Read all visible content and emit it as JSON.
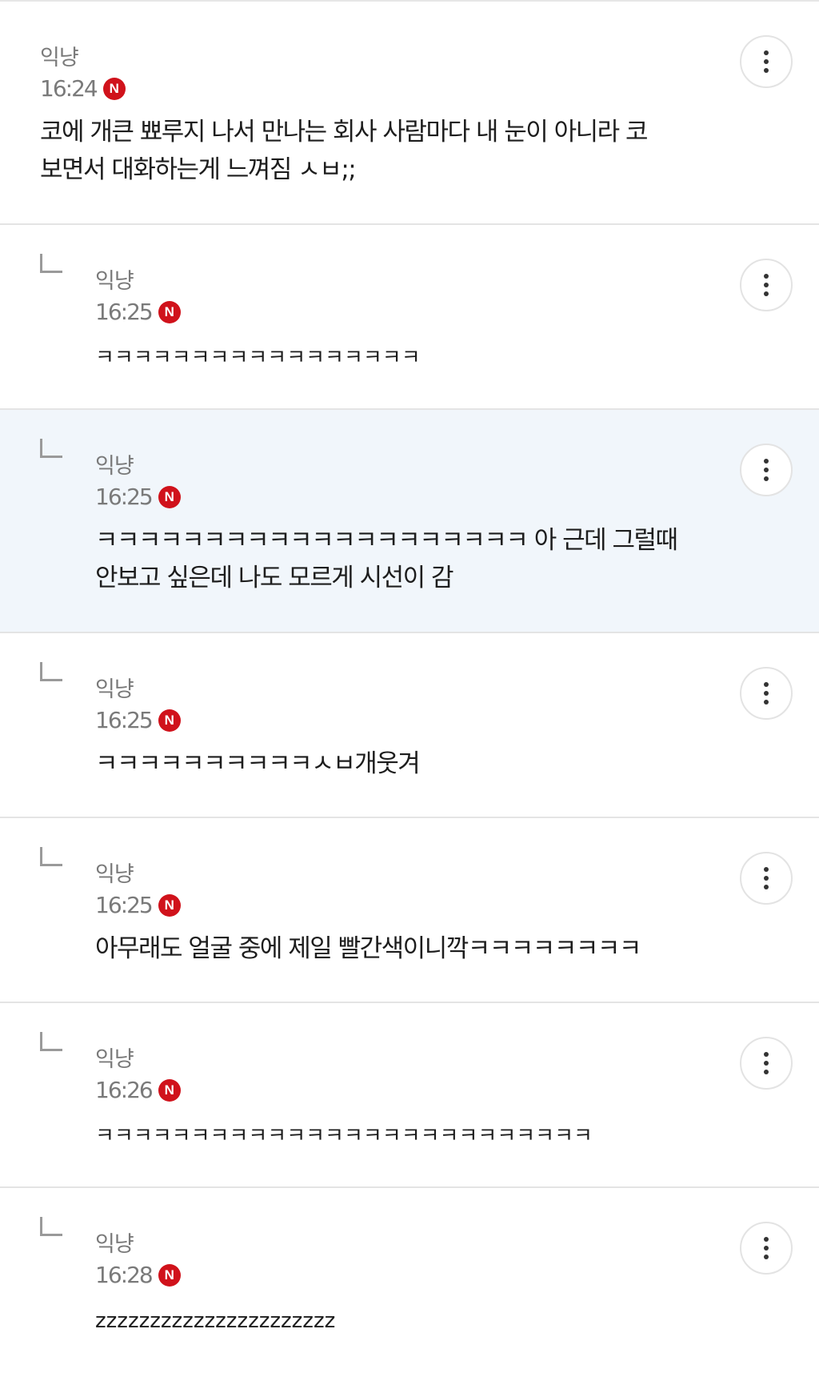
{
  "comments": [
    {
      "author": "익냥",
      "time": "16:24",
      "badge": "N",
      "text": "코에 개큰 뾰루지 나서 만나는 회사 사람마다 내 눈이 아니라 코 보면서 대화하는게 느껴짐 ㅅㅂ;;",
      "is_reply": false,
      "highlighted": false
    },
    {
      "author": "익냥",
      "time": "16:25",
      "badge": "N",
      "text": "ㅋㅋㅋㅋㅋㅋㅋㅋㅋㅋㅋㅋㅋㅋㅋㅋㅋ",
      "is_reply": true,
      "highlighted": false
    },
    {
      "author": "익냥",
      "time": "16:25",
      "badge": "N",
      "text": "ㅋㅋㅋㅋㅋㅋㅋㅋㅋㅋㅋㅋㅋㅋㅋㅋㅋㅋㅋㅋ 아 근데 그럴때 안보고 싶은데 나도 모르게 시선이 감",
      "is_reply": true,
      "highlighted": true
    },
    {
      "author": "익냥",
      "time": "16:25",
      "badge": "N",
      "text": "ㅋㅋㅋㅋㅋㅋㅋㅋㅋㅋㅅㅂ개웃겨",
      "is_reply": true,
      "highlighted": false
    },
    {
      "author": "익냥",
      "time": "16:25",
      "badge": "N",
      "text": "아무래도 얼굴 중에 제일 빨간색이니깍ㅋㅋㅋㅋㅋㅋㅋㅋ",
      "is_reply": true,
      "highlighted": false
    },
    {
      "author": "익냥",
      "time": "16:26",
      "badge": "N",
      "text": "ㅋㅋㅋㅋㅋㅋㅋㅋㅋㅋㅋㅋㅋㅋㅋㅋㅋㅋㅋㅋㅋㅋㅋㅋㅋㅋ",
      "is_reply": true,
      "highlighted": false
    },
    {
      "author": "익냥",
      "time": "16:28",
      "badge": "N",
      "text": "zzzzzzzzzzzzzzzzzzzzzz",
      "is_reply": true,
      "highlighted": false
    }
  ]
}
